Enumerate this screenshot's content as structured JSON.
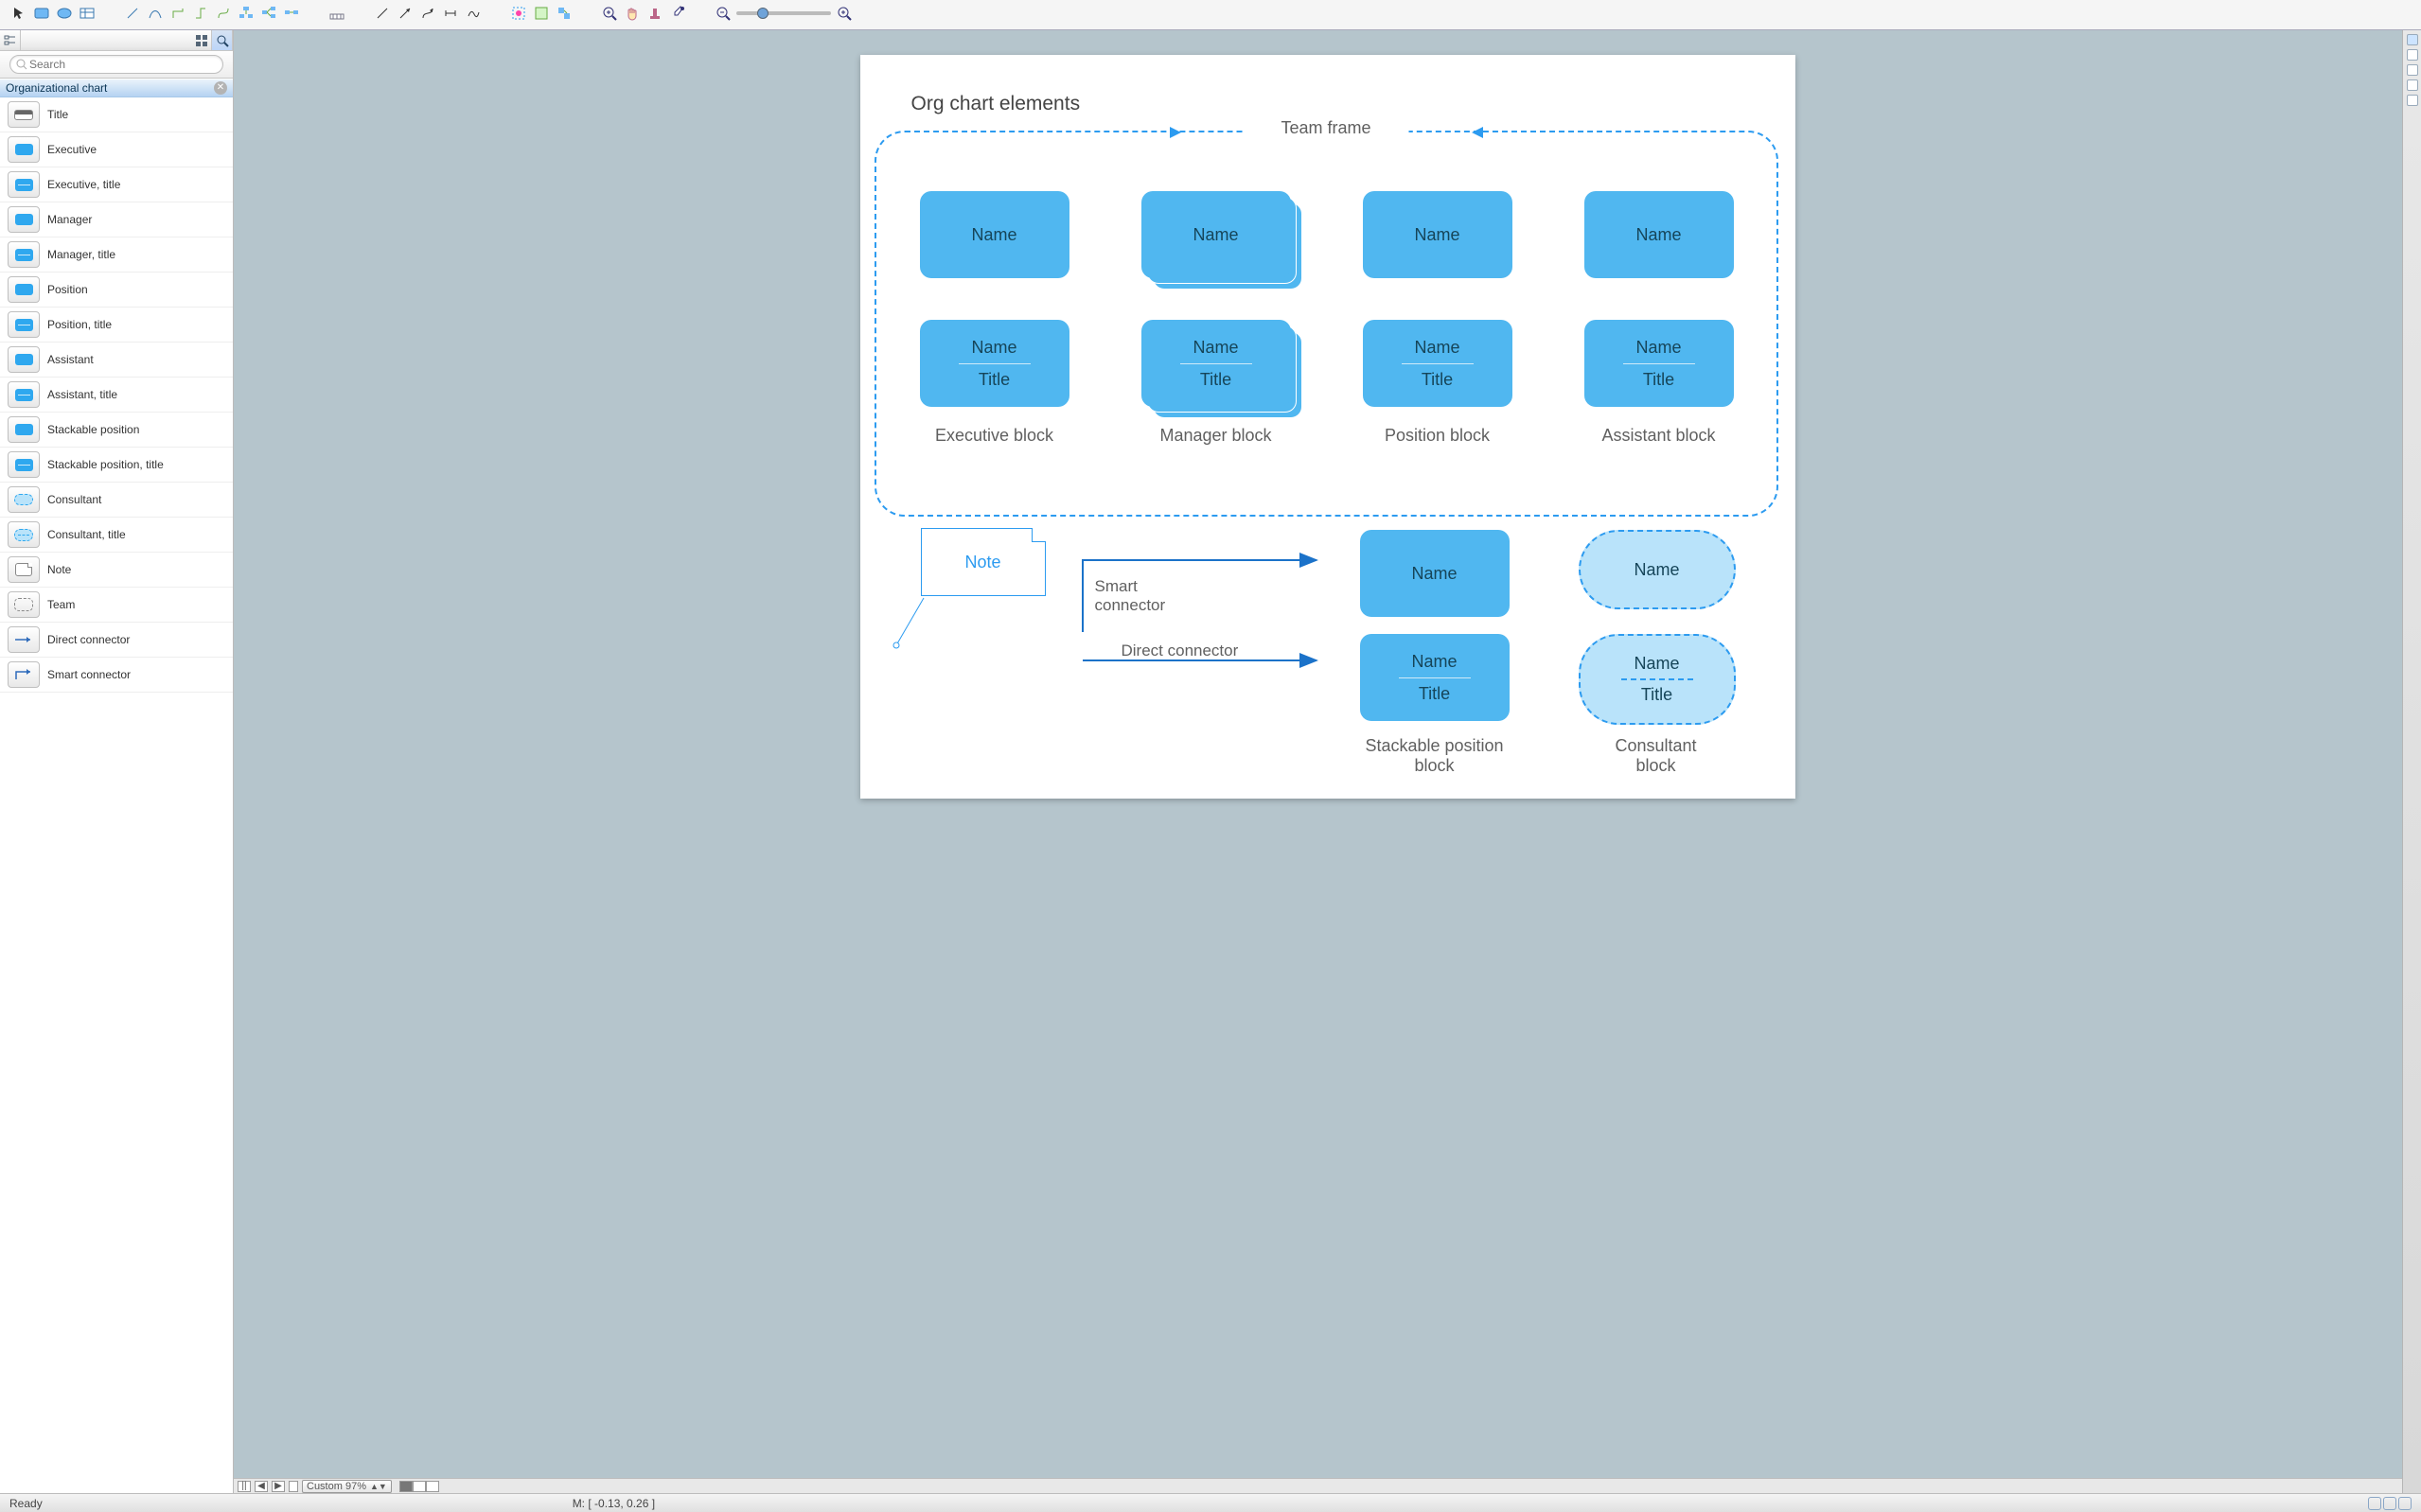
{
  "search": {
    "placeholder": "Search"
  },
  "sidebar": {
    "groupTitle": "Organizational chart",
    "items": [
      {
        "label": "Title",
        "shape": "titlebar"
      },
      {
        "label": "Executive",
        "shape": "blue"
      },
      {
        "label": "Executive, title",
        "shape": "blue-line"
      },
      {
        "label": "Manager",
        "shape": "blue"
      },
      {
        "label": "Manager, title",
        "shape": "blue-line"
      },
      {
        "label": "Position",
        "shape": "blue"
      },
      {
        "label": "Position, title",
        "shape": "blue-line"
      },
      {
        "label": "Assistant",
        "shape": "blue"
      },
      {
        "label": "Assistant, title",
        "shape": "blue-line"
      },
      {
        "label": "Stackable position",
        "shape": "blue"
      },
      {
        "label": "Stackable position, title",
        "shape": "blue-line"
      },
      {
        "label": "Consultant",
        "shape": "dashoval"
      },
      {
        "label": "Consultant, title",
        "shape": "dashoval-line"
      },
      {
        "label": "Note",
        "shape": "note"
      },
      {
        "label": "Team",
        "shape": "team"
      },
      {
        "label": "Direct connector",
        "shape": "direct"
      },
      {
        "label": "Smart connector",
        "shape": "smart"
      }
    ]
  },
  "canvas": {
    "title": "Org chart elements",
    "teamFrameLabel": "Team frame",
    "name": "Name",
    "titleWord": "Title",
    "captions": {
      "exec": "Executive block",
      "mgr": "Manager block",
      "pos": "Position block",
      "asst": "Assistant block",
      "stack": "Stackable position\nblock",
      "cons": "Consultant\nblock"
    },
    "note": "Note",
    "smart": "Smart\nconnector",
    "direct": "Direct connector"
  },
  "hscroll": {
    "zoom": "Custom 97%"
  },
  "status": {
    "ready": "Ready",
    "mouse": "M: [ -0.13, 0.26 ]"
  }
}
